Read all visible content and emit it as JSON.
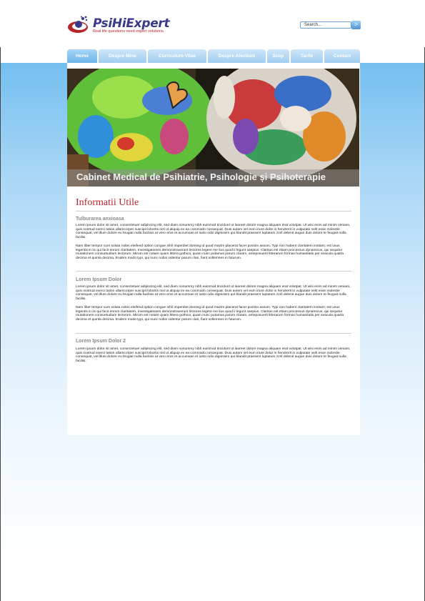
{
  "brand": {
    "name_part1": "PsiHi",
    "name_part2": "Expert",
    "tagline": "Real life questions need expert solutions."
  },
  "search": {
    "placeholder": "Search...",
    "button": ">"
  },
  "nav": {
    "tabs": [
      "Home",
      "Despre Mine",
      "Curriculum-Vitae",
      "Despre Afectiuni",
      "Scop",
      "Tarife",
      "Contact"
    ],
    "active": "Home"
  },
  "hero": {
    "caption": "Cabinet Medical de Psihiatrie, Psihologie și Psihoterapie"
  },
  "page": {
    "title": "Informatii Utile"
  },
  "sections": [
    {
      "heading": "Tulburarea anxioasa",
      "p1": "Lorem ipsum dolor sit amet, consectetuer adipiscing elit, sed diam nonummy nibh euismod tincidunt ut laoreet dolore magna aliquam erat volutpat. Ut wisi enim ad minim veniam, quis nostrud exerci tation ullamcorper suscipit lobortis nisl ut aliquip ex ea commodo consequat. Duis autem vel eum iriure dolor in hendrerit in vulputate velit esse molestie consequat, vel illum dolore eu feugiat nulla facilisis at vero eros et accumsan et iusto odio dignissim qui blandit praesent luptatum zzril delenit augue duis dolore te feugait nulla facilisi.",
      "p2": "Nam liber tempor cum soluta nobis eleifend option congue nihil imperdiet doming id quod mazim placerat facer possim assum. Typi non habent claritatem insitam; est usus legentis in iis qui facit eorum claritatem. Investigationes demonstraverunt lectores legere me lius quod ii legunt saepius. Claritas est etiam processus dynamicus, qui sequitur mutationem consuetudium lectorum. Mirum est notare quam littera gothica, quam nunc putamus parum claram, anteposuerit litterarum formas humanitatis per seacula quarta decima et quinta decima. Eodem modo typi, qui nunc nobis videntur parum clari, fiant sollemnes in futurum."
    },
    {
      "heading": "Lorem Ipsum Dolor",
      "p1": "Lorem ipsum dolor sit amet, consectetuer adipiscing elit, sed diam nonummy nibh euismod tincidunt ut laoreet dolore magna aliquam erat volutpat. Ut wisi enim ad minim veniam, quis nostrud exerci tation ullamcorper suscipit lobortis nisl ut aliquip ex ea commodo consequat. Duis autem vel eum iriure dolor in hendrerit in vulputate velit esse molestie consequat, vel illum dolore eu feugiat nulla facilisis at vero eros et accumsan et iusto odio dignissim qui blandit praesent luptatum zzril delenit augue duis dolore te feugait nulla facilisi.",
      "p2": "Nam liber tempor cum soluta nobis eleifend option congue nihil imperdiet doming id quod mazim placerat facer possim assum. Typi non habent claritatem insitam; est usus legentis in iis qui facit eorum claritatem. Investigationes demonstraverunt lectores legere me lius quod ii legunt saepius. Claritas est etiam processus dynamicus, qui sequitur mutationem consuetudium lectorum. Mirum est notare quam littera gothica, quam nunc putamus parum claram, anteposuerit litterarum formas humanitatis per seacula quarta decima et quinta decima. Eodem modo typi, qui nunc nobis videntur parum clari, fiant sollemnes in futurum."
    },
    {
      "heading": "Lorem Ipsum Dolor 2",
      "p1": "Lorem ipsum dolor sit amet, consectetuer adipiscing elit, sed diam nonummy nibh euismod tincidunt ut laoreet dolore magna aliquam erat volutpat. Ut wisi enim ad minim veniam, quis nostrud exerci tation ullamcorper suscipit lobortis nisl ut aliquip ex ea commodo consequat. Duis autem vel eum iriure dolor in hendrerit in vulputate velit esse molestie consequat, vel illum dolore eu feugiat nulla facilisis at vero eros et accumsan et iusto odio dignissim qui blandit praesent luptatum zzril delenit augue duis dolore te feugait nulla facilisi."
    }
  ]
}
